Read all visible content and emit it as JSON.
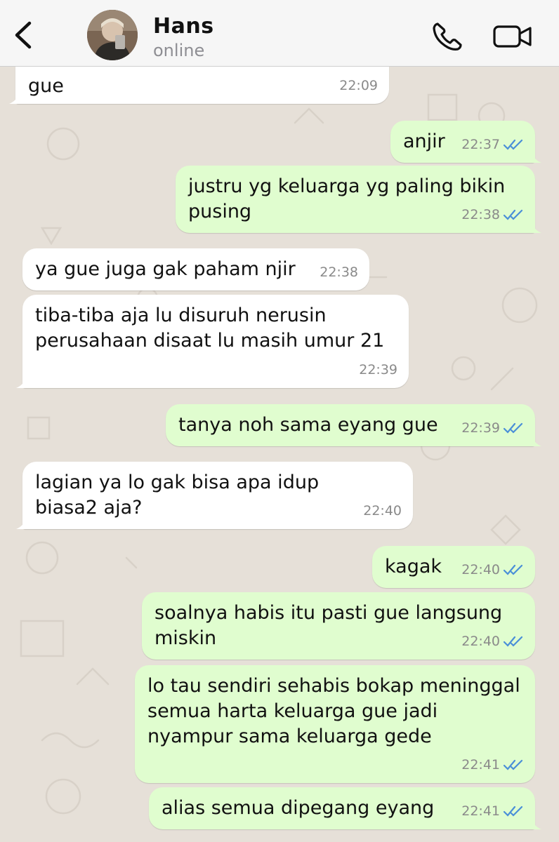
{
  "header": {
    "contact_name": "Hans",
    "status": "online"
  },
  "colors": {
    "incoming_bubble": "#ffffff",
    "outgoing_bubble": "#e0fdcf",
    "read_ticks": "#4a8fd8",
    "wallpaper": "#e6e0d8"
  },
  "messages": [
    {
      "direction": "in",
      "text": "gue",
      "time": "22:09"
    },
    {
      "direction": "out",
      "text": "anjir",
      "time": "22:37",
      "status": "read"
    },
    {
      "direction": "out",
      "text": "justru yg keluarga yg paling bikin pusing",
      "time": "22:38",
      "status": "read"
    },
    {
      "direction": "in",
      "text": "ya gue juga gak paham njir",
      "time": "22:38"
    },
    {
      "direction": "in",
      "text": "tiba-tiba aja lu disuruh nerusin perusahaan disaat lu masih umur 21",
      "time": "22:39"
    },
    {
      "direction": "out",
      "text": "tanya noh sama eyang gue",
      "time": "22:39",
      "status": "read"
    },
    {
      "direction": "in",
      "text": "lagian ya lo gak bisa apa idup biasa2 aja?",
      "time": "22:40"
    },
    {
      "direction": "out",
      "text": "kagak",
      "time": "22:40",
      "status": "read"
    },
    {
      "direction": "out",
      "text": "soalnya habis itu pasti gue langsung miskin",
      "time": "22:40",
      "status": "read"
    },
    {
      "direction": "out",
      "text": "lo tau sendiri sehabis bokap meninggal semua harta keluarga gue jadi nyampur sama keluarga gede",
      "time": "22:41",
      "status": "read"
    },
    {
      "direction": "out",
      "text": "alias semua dipegang eyang",
      "time": "22:41",
      "status": "read"
    }
  ]
}
